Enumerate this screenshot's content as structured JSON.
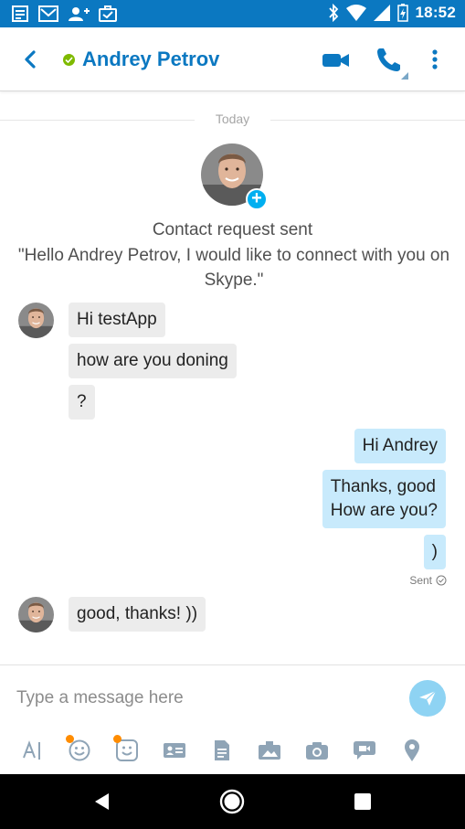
{
  "status_bar": {
    "time": "18:52",
    "icons": [
      "notes-icon",
      "gmail-icon",
      "add-person-icon",
      "briefcase-icon",
      "bluetooth-icon",
      "wifi-icon",
      "signal-icon",
      "battery-charging-icon"
    ]
  },
  "app_bar": {
    "contact_name": "Andrey Petrov",
    "presence": "online",
    "accent_color": "#0b78c1",
    "presence_color": "#7fba00"
  },
  "conversation": {
    "date_label": "Today",
    "contact_request": {
      "title": "Contact request sent",
      "message": "\"Hello Andrey Petrov, I would like to connect with you on Skype.\""
    },
    "incoming_group_1": [
      "Hi testApp",
      "how are you doning",
      "?"
    ],
    "outgoing_group": [
      "Hi Andrey",
      "Thanks, good\nHow are you?",
      ")"
    ],
    "sent_status": "Sent",
    "incoming_group_2": [
      "good, thanks! ))"
    ],
    "incoming_bubble_color": "#ececec",
    "outgoing_bubble_color": "#c8eafc"
  },
  "compose": {
    "placeholder": "Type a message here",
    "send_button_color": "#8ed3f3",
    "tools": [
      "text-format-icon",
      "emoticon-icon",
      "moji-icon",
      "contact-card-icon",
      "file-icon",
      "media-bar-icon",
      "camera-icon",
      "video-message-icon",
      "location-icon"
    ]
  },
  "nav_bar": {
    "buttons": [
      "back-icon",
      "home-icon",
      "recents-icon"
    ]
  }
}
